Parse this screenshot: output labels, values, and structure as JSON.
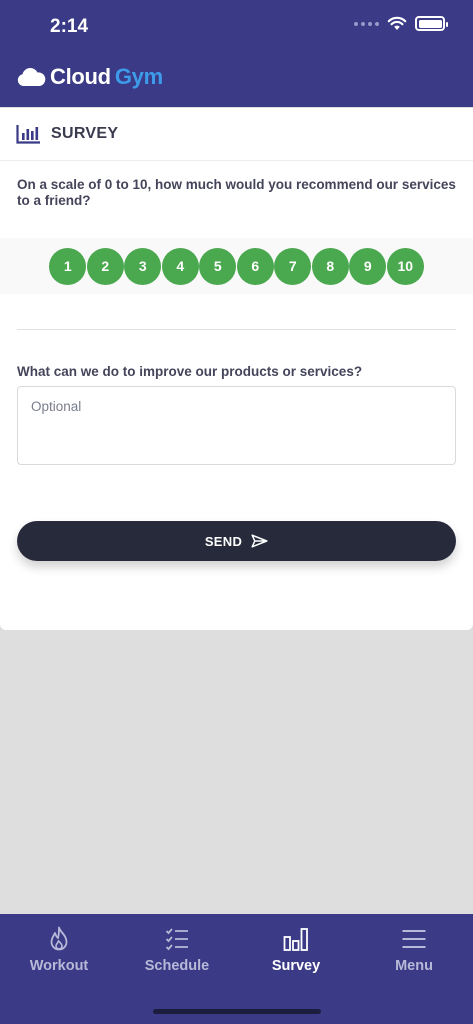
{
  "status_bar": {
    "time": "2:14"
  },
  "brand": {
    "name_part1": "Cloud",
    "name_part2": "Gym"
  },
  "survey": {
    "title": "SURVEY",
    "question": "On a scale of 0 to 10, how much would you recommend our services to a friend?",
    "ratings": [
      "1",
      "2",
      "3",
      "4",
      "5",
      "6",
      "7",
      "8",
      "9",
      "10"
    ],
    "improve_label": "What can we do to improve our products or services?",
    "improve_placeholder": "Optional",
    "send_label": "SEND"
  },
  "tabs": [
    {
      "label": "Workout",
      "icon": "flame-icon",
      "active": false
    },
    {
      "label": "Schedule",
      "icon": "checklist-icon",
      "active": false
    },
    {
      "label": "Survey",
      "icon": "bar-chart-icon",
      "active": true
    },
    {
      "label": "Menu",
      "icon": "hamburger-menu-icon",
      "active": false
    }
  ],
  "colors": {
    "brand_primary": "#3a3a86",
    "brand_accent": "#3d9be9",
    "rating_green": "#4aa84f",
    "send_button": "#272a3b",
    "background": "#dedede"
  }
}
